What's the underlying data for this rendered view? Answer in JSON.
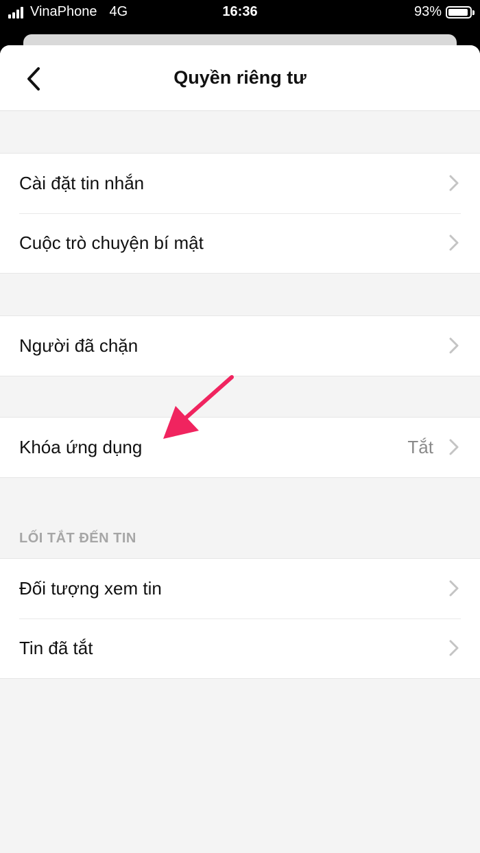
{
  "status_bar": {
    "carrier": "VinaPhone",
    "network": "4G",
    "time": "16:36",
    "battery_percent_text": "93%",
    "battery_level": 0.93
  },
  "header": {
    "title": "Quyền riêng tư",
    "back_icon": "chevron-left-icon"
  },
  "groups": {
    "messages": {
      "items": [
        {
          "label": "Cài đặt tin nhắn"
        },
        {
          "label": "Cuộc trò chuyện bí mật"
        }
      ]
    },
    "blocked": {
      "items": [
        {
          "label": "Người đã chặn"
        }
      ]
    },
    "app_lock": {
      "items": [
        {
          "label": "Khóa ứng dụng",
          "value": "Tắt"
        }
      ]
    },
    "stories": {
      "header": "LỐI TẮT ĐẾN TIN",
      "items": [
        {
          "label": "Đối tượng xem tin"
        },
        {
          "label": "Tin đã tắt"
        }
      ]
    }
  },
  "colors": {
    "annotation_arrow": "#f0245f",
    "background": "#f4f4f4",
    "secondary_text": "#8a8a8a"
  }
}
